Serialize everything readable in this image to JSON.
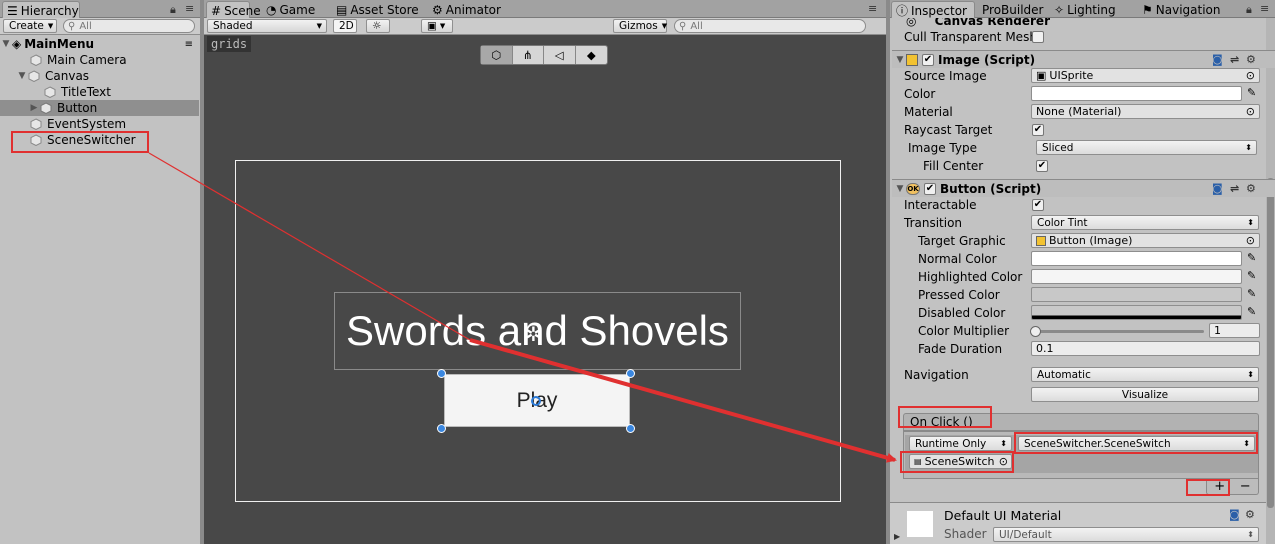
{
  "hierarchy": {
    "tab": "Hierarchy",
    "create": "Create",
    "search_placeholder": "All",
    "scene": "MainMenu",
    "items": [
      "Main Camera",
      "Canvas",
      "TitleText",
      "Button",
      "EventSystem",
      "SceneSwitcher"
    ]
  },
  "scene_tabs": {
    "scene": "Scene",
    "game": "Game",
    "asset_store": "Asset Store",
    "animator": "Animator"
  },
  "scene_toolbar": {
    "shading": "Shaded",
    "mode_2d": "2D",
    "gizmos": "Gizmos",
    "search_placeholder": "All"
  },
  "scene_view": {
    "grids_label": "grids",
    "title_text": "Swords and Shovels",
    "button_text": "Play"
  },
  "inspector_tabs": {
    "inspector": "Inspector",
    "probuilder": "ProBuilder",
    "lighting": "Lighting",
    "navigation": "Navigation"
  },
  "canvas_renderer": {
    "title": "Canvas Renderer",
    "cull_label": "Cull Transparent Mesh"
  },
  "image_script": {
    "title": "Image (Script)",
    "source_image_label": "Source Image",
    "source_image": "UISprite",
    "color_label": "Color",
    "material_label": "Material",
    "material": "None (Material)",
    "raycast_label": "Raycast Target",
    "image_type_label": "Image Type",
    "image_type": "Sliced",
    "fill_center_label": "Fill Center"
  },
  "button_script": {
    "title": "Button (Script)",
    "interactable_label": "Interactable",
    "transition_label": "Transition",
    "transition": "Color Tint",
    "target_graphic_label": "Target Graphic",
    "target_graphic": "Button (Image)",
    "normal_label": "Normal Color",
    "highlighted_label": "Highlighted Color",
    "pressed_label": "Pressed Color",
    "disabled_label": "Disabled Color",
    "multiplier_label": "Color Multiplier",
    "multiplier": "1",
    "fade_label": "Fade Duration",
    "fade": "0.1",
    "navigation_label": "Navigation",
    "navigation": "Automatic",
    "visualize": "Visualize",
    "onclick_label": "On Click ()",
    "runtime": "Runtime Only",
    "function": "SceneSwitcher.SceneSwitch",
    "object": "SceneSwitch",
    "plus": "+",
    "minus": "−"
  },
  "material": {
    "title": "Default UI Material",
    "shader_label": "Shader",
    "shader": "UI/Default"
  },
  "colors": {
    "highlight": "#e03030",
    "selection": "#8f8f8f"
  }
}
